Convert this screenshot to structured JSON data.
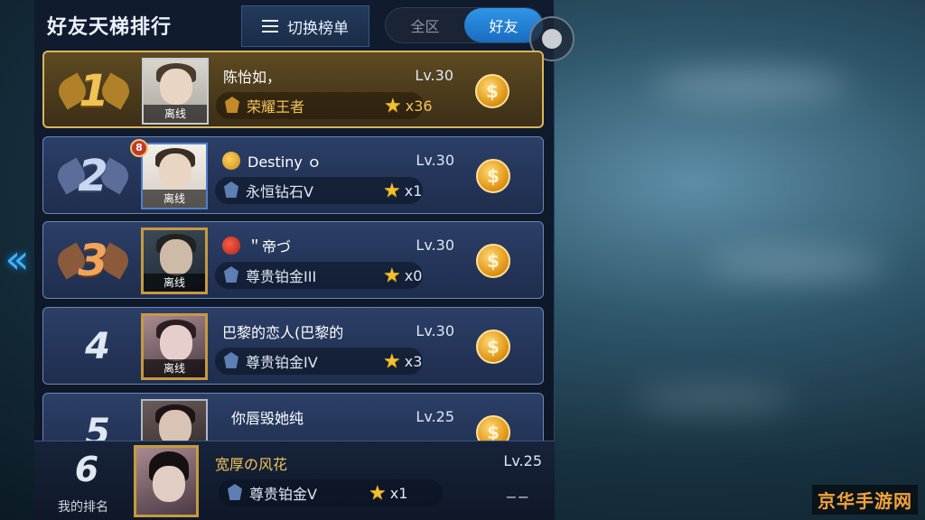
{
  "header": {
    "title": "好友天梯排行",
    "switch_label": "切换榜单",
    "tabs": [
      {
        "label": "全区",
        "active": false
      },
      {
        "label": "好友",
        "active": true
      }
    ]
  },
  "rows": [
    {
      "rank": "1",
      "name": "陈怡如，",
      "level": "Lv.30",
      "status": "离线",
      "tier": "荣耀王者",
      "stars": "x36"
    },
    {
      "rank": "2",
      "name": "Destiny ｏ",
      "level": "Lv.30",
      "status": "离线",
      "tier": "永恒钻石V",
      "stars": "x1",
      "badge": "8"
    },
    {
      "rank": "3",
      "name": "＂帝づ",
      "level": "Lv.30",
      "status": "离线",
      "tier": "尊贵铂金III",
      "stars": "x0"
    },
    {
      "rank": "4",
      "name": "巴黎的恋人(巴黎的",
      "level": "Lv.30",
      "status": "离线",
      "tier": "尊贵铂金IV",
      "stars": "x3"
    },
    {
      "rank": "5",
      "name": "你唇毁她纯",
      "level": "Lv.25"
    }
  ],
  "my_rank": {
    "rank": "6",
    "label": "我的排名",
    "name": "宽厚の风花",
    "level": "Lv.25",
    "tier": "尊贵铂金V",
    "stars": "x1",
    "extra": "−−"
  },
  "watermark": "京华手游网",
  "colors": {
    "accent": "#2f95e8",
    "gold": "#f3c35c",
    "panel": "#101c2e"
  }
}
